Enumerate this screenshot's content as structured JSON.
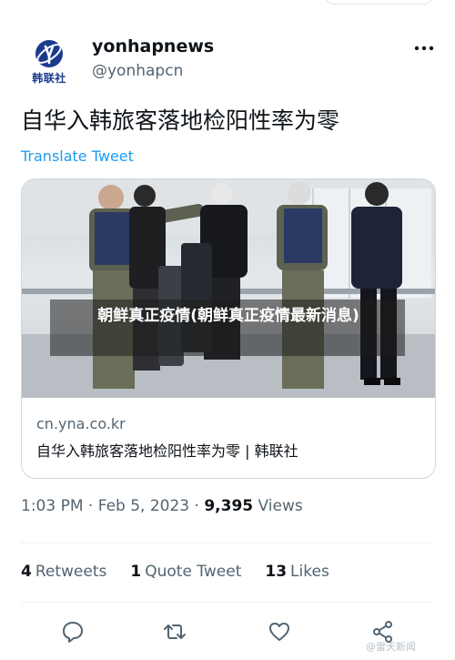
{
  "author": {
    "name": "yonhapnews",
    "handle": "@yonhapcn",
    "avatar_text": "韩联社"
  },
  "tweet": {
    "text": "自华入韩旅客落地检阳性率为零",
    "translate_label": "Translate Tweet"
  },
  "card": {
    "overlay_text": "朝鲜真正疫情(朝鲜真正疫情最新消息)",
    "domain": "cn.yna.co.kr",
    "title": "自华入韩旅客落地检阳性率为零 | 韩联社"
  },
  "meta": {
    "time": "1:03 PM",
    "date": "Feb 5, 2023",
    "separator": "·",
    "views_count": "9,395",
    "views_label": "Views"
  },
  "stats": {
    "retweets_count": "4",
    "retweets_label": "Retweets",
    "quotes_count": "1",
    "quotes_label": "Quote Tweet",
    "likes_count": "13",
    "likes_label": "Likes"
  },
  "icons": {
    "more": "more-icon",
    "reply": "reply-icon",
    "retweet": "retweet-icon",
    "like": "heart-icon",
    "share": "share-icon"
  },
  "watermark": "@雷天新闻",
  "colors": {
    "accent": "#1d9bf0",
    "text": "#0f1419",
    "secondary": "#536471",
    "border": "#cfd9de"
  }
}
